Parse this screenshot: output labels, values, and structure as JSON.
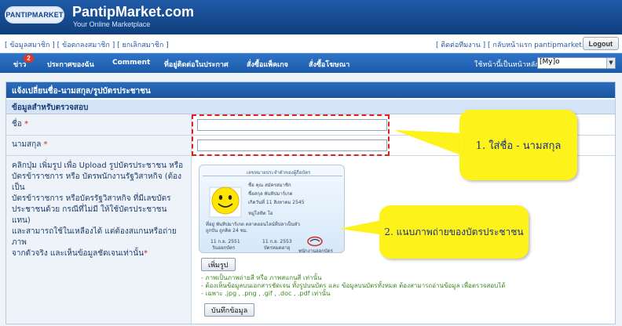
{
  "header": {
    "logo_text": "PANTIPMARKET",
    "title": "PantipMarket.com",
    "tagline": "Your Online Marketplace"
  },
  "toolbar": {
    "left_links": [
      "[ ข้อมูลสมาชิก ]",
      "[ ข้อตกลงสมาชิก ]",
      "[ ยกเลิกสมาชิก ]"
    ],
    "right_links": [
      "[ ติดต่อทีมงาน ]",
      "[ กลับหน้าแรก pantipmarket.com ]"
    ],
    "logout_label": "Logout"
  },
  "nav": {
    "items": [
      "ข่าว",
      "ประกาศของฉัน",
      "Comment",
      "ที่อยู่ติดต่อในประกาศ",
      "สั่งซื้อแพ็คเกจ",
      "สั่งซื้อโฆษณา"
    ],
    "news_badge": "2",
    "home_label": "ใช้หน้านี้เป็นหน้าหลัก :",
    "home_select_value": "[My]o"
  },
  "panel": {
    "title": "แจ้งเปลี่ยนชื่อ-นามสกุล/รูปบัตรประชาชน",
    "section_title": "ข้อมูลสำหรับตรวจสอบ",
    "first_name_label": "ชื่อ",
    "last_name_label": "นามสกุล",
    "required_mark": "*",
    "upload_desc_lines": [
      "คลิกปุ่ม เพิ่มรูป เพื่อ Upload รูปบัตรประชาชน หรือ",
      "บัตรข้าราชการ หรือ บัตรพนักงานรัฐวิสาหกิจ (ต้องเป็น",
      "บัตรข้าราชการ หรือบัตรรัฐวิสาหกิจ ที่มีเลขบัตร",
      "ประชาชนด้วย กรณีที่ไม่มี ให้ใช้บัตรประชาชนแทน)",
      "และสามารถใช้ในเหลืองได้ แต่ต้องสแกนหรือถ่ายภาพ",
      "จากตัวจริง และเห็นข้อมูลชัดเจนเท่านั้น"
    ],
    "upload_button": "เพิ่มรูป",
    "notes": [
      "- ภาพเป็นภาพถ่ายสี หรือ ภาพสแกนสี เท่านั้น",
      "- ต้องเห็นข้อมูลบนเอกสารชัดเจน ทั้งรูปบนบัตร และ ข้อมูลบนบัตรทั้งหมด ต้องสามารถอ่านข้อมูล เพื่อตรวจสอบได้",
      "- เฉพาะ .jpg , .png , .gif , .doc , .pdf เท่านั้น"
    ],
    "save_button": "บันทึกข้อมูล"
  },
  "id_card": {
    "header": "เลขหมายประจำตัวของผู้ถือบัตร",
    "lines": [
      "ชื่อ    คุณ  สมัครสมาชิก",
      "ชื่อสกุล   พันทิปมาร์เกต",
      "เกิดวันที่   11  สิงหาคม 2545",
      "หมู่โลหิต   โอ",
      "ที่อยู่  พันทิปมาร์เกต ตลาดออนไลน์ที่ปลาเป็นหัว",
      "        ถูกปัน ถูกคิด 24 ชม.",
      "11 ก.ย. 2551",
      "วันออกบัตร",
      "11 ก.ย. 2553",
      "บัตรหมดอายุ",
      "พนักงานออกบัตร"
    ]
  },
  "callouts": {
    "first": "1. ใส่ชื่อ - นามสกุล",
    "second": "2. แนบภาพถ่ายของบัตรประชาชน"
  },
  "colors": {
    "header_blue": "#1f5aa6",
    "nav_blue": "#2f74c7",
    "callout_yellow": "#fdf31a",
    "dash_red": "#e02020"
  }
}
